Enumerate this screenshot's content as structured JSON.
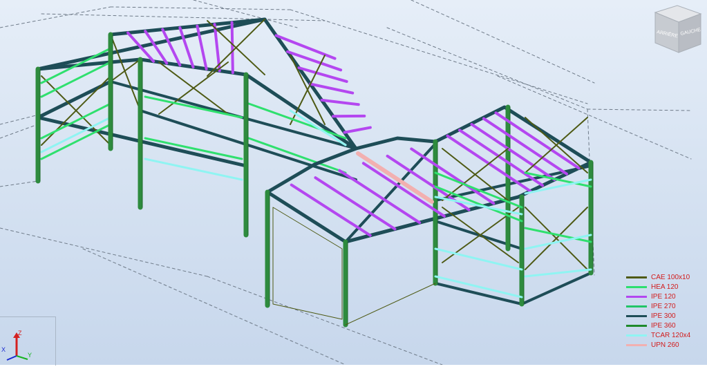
{
  "view_cube": {
    "faces": [
      "ARRIÈRE",
      "GAUCHE"
    ]
  },
  "axes": {
    "z": "Z",
    "x": "X",
    "y": "Y"
  },
  "colors": {
    "column": "#2e8b3e",
    "column_edge": "#1f6a2a",
    "rafter": "#1e4d57",
    "purlin": "#b447f0",
    "brace": "#4e5a14",
    "rail": "#2fe06e",
    "sill": "#8ff4f2",
    "channel": "#f2b0b0",
    "grid": "#6e7a88"
  },
  "legend": [
    {
      "label": "CAE 100x10",
      "color": "#4e5a14"
    },
    {
      "label": "HEA 120",
      "color": "#2ddf6f"
    },
    {
      "label": "IPE 120",
      "color": "#b447f0"
    },
    {
      "label": "IPE 270",
      "color": "#21c567"
    },
    {
      "label": "IPE 300",
      "color": "#1e4d57"
    },
    {
      "label": "IPE 360",
      "color": "#1e8a2a"
    },
    {
      "label": "TCAR 120x4",
      "color": "#8ff4f2"
    },
    {
      "label": "UPN 260",
      "color": "#f2b0b0"
    }
  ]
}
